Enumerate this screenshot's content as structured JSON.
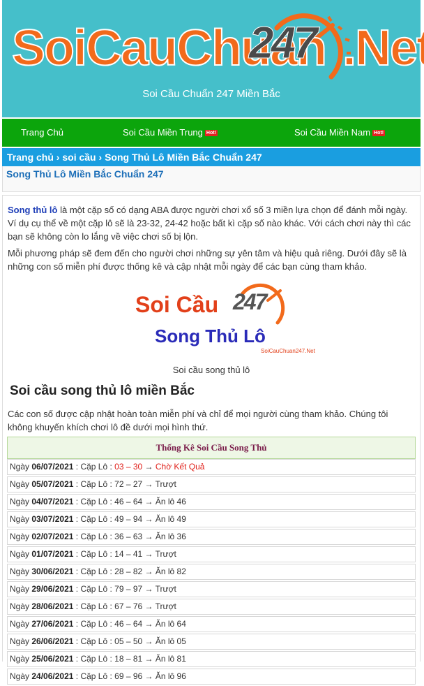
{
  "header": {
    "logo": {
      "part1": "SoiCauChuan",
      "number": "247",
      "part2": ".Net"
    },
    "tagline": "Soi Cầu Chuẩn 247 Miền Bắc"
  },
  "nav": {
    "items": [
      {
        "label": "Trang Chủ",
        "hot": ""
      },
      {
        "label": "Soi Cầu Miền Trung",
        "hot": "Hot!"
      },
      {
        "label": "Soi Cầu Miền Nam",
        "hot": "Hot!"
      }
    ]
  },
  "breadcrumb": {
    "home": "Trang chủ",
    "sep": "›",
    "section": "soi cầu",
    "current": "Song Thủ Lô Miền Bắc Chuẩn 247"
  },
  "page_title": "Song Thủ Lô Miền Bắc Chuẩn 247",
  "intro": {
    "keyword": "Song thủ lô",
    "p1_rest": " là một cặp số có dạng ABA được người chơi xổ số 3 miền lựa chọn để đánh mỗi ngày. Ví dụ cụ thể về một cặp lô sẽ là 23-32, 24-42 hoặc bất kì cặp số nào khác. Với cách chơi này thì các bạn sẽ không còn lo lắng về việc chơi số bị lộn.",
    "p2": "Mỗi phương pháp sẽ đem đến cho người chơi những sự yên tâm và hiệu quả riêng. Dưới đây sẽ là những con số miễn phí được thống kê và cập nhật mỗi ngày để các bạn cùng tham khảo."
  },
  "image": {
    "line1": "Soi Cầu",
    "number": "247",
    "line2": "Song Thủ Lô",
    "small": "SoiCauChuan247.Net",
    "caption": "Soi cầu song thủ lô"
  },
  "section": {
    "heading": "Soi cầu song thủ lô miền Bắc",
    "desc": "Các con số được cập nhật hoàn toàn miễn phí và chỉ để mọi người cùng tham khảo. Chúng tôi không khuyến khích chơi lô đề dưới mọi hình thứ."
  },
  "stats": {
    "header": "Thống Kê Soi Cầu Song Thủ",
    "day_label": "Ngày",
    "pair_label": "Cặp Lô",
    "rows": [
      {
        "date": "06/07/2021",
        "pair": "03 – 30",
        "result": "Chờ Kết Quả",
        "pending": true
      },
      {
        "date": "05/07/2021",
        "pair": "72 – 27",
        "result": "Trượt",
        "pending": false
      },
      {
        "date": "04/07/2021",
        "pair": "46 – 64",
        "result": "Ăn lô 46",
        "pending": false
      },
      {
        "date": "03/07/2021",
        "pair": "49 – 94",
        "result": "Ăn lô 49",
        "pending": false
      },
      {
        "date": "02/07/2021",
        "pair": "36 – 63",
        "result": "Ăn lô 36",
        "pending": false
      },
      {
        "date": "01/07/2021",
        "pair": "14 – 41",
        "result": "Trượt",
        "pending": false
      },
      {
        "date": "30/06/2021",
        "pair": "28 – 82",
        "result": "Ăn lô 82",
        "pending": false
      },
      {
        "date": "29/06/2021",
        "pair": "79 – 97",
        "result": "Trượt",
        "pending": false
      },
      {
        "date": "28/06/2021",
        "pair": "67 – 76",
        "result": "Trượt",
        "pending": false
      },
      {
        "date": "27/06/2021",
        "pair": "46 – 64",
        "result": "Ăn lô 64",
        "pending": false
      },
      {
        "date": "26/06/2021",
        "pair": "05 – 50",
        "result": "Ăn lô 05",
        "pending": false
      },
      {
        "date": "25/06/2021",
        "pair": "18 – 81",
        "result": "Ăn lô 81",
        "pending": false
      },
      {
        "date": "24/06/2021",
        "pair": "69 – 96",
        "result": "Ăn lô 96",
        "pending": false
      }
    ]
  },
  "colors": {
    "header_bg": "#45bfca",
    "nav_bg": "#0ca50c",
    "breadcrumb_bg": "#1a9ee0",
    "logo_orange": "#f26a1b",
    "pending_red": "#e0201a"
  }
}
